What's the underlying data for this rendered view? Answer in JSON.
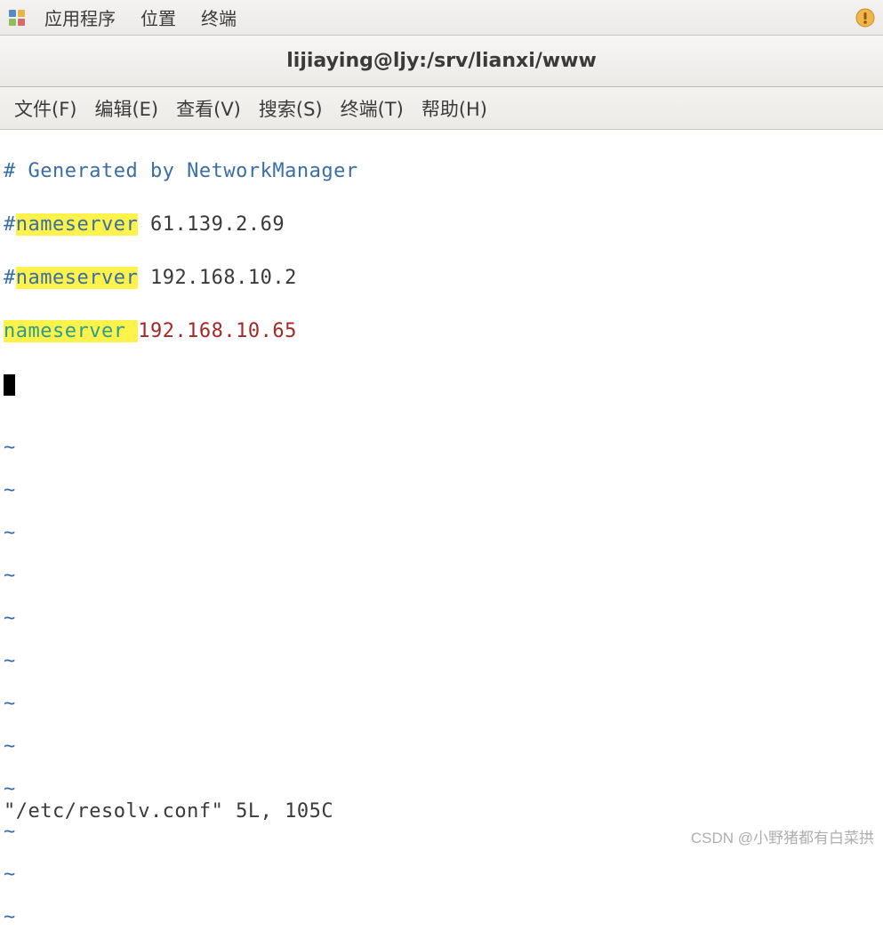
{
  "top_panel": {
    "applications": "应用程序",
    "places": "位置",
    "terminal": "终端"
  },
  "window": {
    "title": "lijiaying@ljy:/srv/lianxi/www"
  },
  "menubar": {
    "file": "文件(F)",
    "edit": "编辑(E)",
    "view": "查看(V)",
    "search": "搜索(S)",
    "terminal": "终端(T)",
    "help": "帮助(H)"
  },
  "content": {
    "line1_comment": "# Generated by NetworkManager",
    "line2_hash": "#",
    "line2_ns": "nameserver",
    "line2_ip": " 61.139.2.69",
    "line3_hash": "#",
    "line3_ns": "nameserver",
    "line3_ip": " 192.168.10.2",
    "line4_ns": "nameserver",
    "line4_space": " ",
    "line4_ip": "192.168.10.65",
    "tilde": "~"
  },
  "status": "\"/etc/resolv.conf\" 5L, 105C",
  "watermark": "CSDN @小野猪都有白菜拱"
}
